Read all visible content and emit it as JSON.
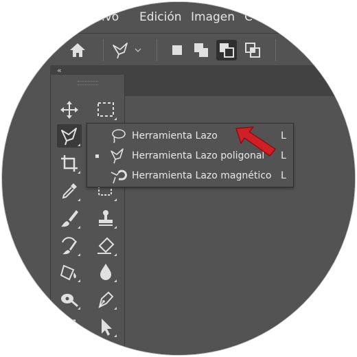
{
  "menubar": {
    "items": [
      {
        "label": "ivo"
      },
      {
        "label": "Edición"
      },
      {
        "label": "Imagen"
      },
      {
        "label": "C"
      }
    ]
  },
  "options_bar": {
    "home_icon": "home-icon",
    "tool_preset_icon": "polygonal-lasso-icon",
    "selection_modes": [
      "new-selection",
      "add-to-selection",
      "subtract-from-selection",
      "intersect-selection"
    ],
    "active_mode": "subtract-from-selection"
  },
  "toolbar": {
    "collapse_label": "‹‹",
    "tools": [
      {
        "name": "move-tool",
        "icon": "move-icon"
      },
      {
        "name": "rectangular-marquee-tool",
        "icon": "marquee-icon"
      },
      {
        "name": "lasso-tool",
        "icon": "polygonal-lasso-icon",
        "active": true
      },
      {
        "name": "crop-tool",
        "icon": "crop-icon"
      },
      {
        "name": "eyedropper-tool",
        "icon": "eyedropper-icon"
      },
      {
        "name": "spot-healing-tool",
        "icon": "bandage-icon"
      },
      {
        "name": "brush-tool",
        "icon": "brush-icon"
      },
      {
        "name": "clone-stamp-tool",
        "icon": "stamp-icon"
      },
      {
        "name": "history-brush-tool",
        "icon": "history-brush-icon"
      },
      {
        "name": "eraser-tool",
        "icon": "eraser-icon"
      },
      {
        "name": "paint-bucket-tool",
        "icon": "paint-bucket-icon"
      },
      {
        "name": "blur-tool",
        "icon": "drop-icon"
      },
      {
        "name": "dodge-tool",
        "icon": "dodge-icon"
      },
      {
        "name": "pen-tool",
        "icon": "pen-icon"
      },
      {
        "name": "type-tool",
        "icon": "type-icon"
      },
      {
        "name": "path-selection-tool",
        "icon": "arrow-cursor-icon"
      }
    ]
  },
  "flyout": {
    "items": [
      {
        "label": "Herramienta Lazo",
        "shortcut": "L",
        "icon": "lasso-icon",
        "selected": false
      },
      {
        "label": "Herramienta Lazo poligonal",
        "shortcut": "L",
        "icon": "polygonal-lasso-icon",
        "selected": true
      },
      {
        "label": "Herramienta Lazo magnético",
        "shortcut": "L",
        "icon": "magnetic-lasso-icon",
        "selected": false
      }
    ]
  },
  "colors": {
    "panel": "#535353",
    "dark_panel": "#424242",
    "text": "#e6e6e6",
    "pointer_arrow": "#d01f25"
  }
}
